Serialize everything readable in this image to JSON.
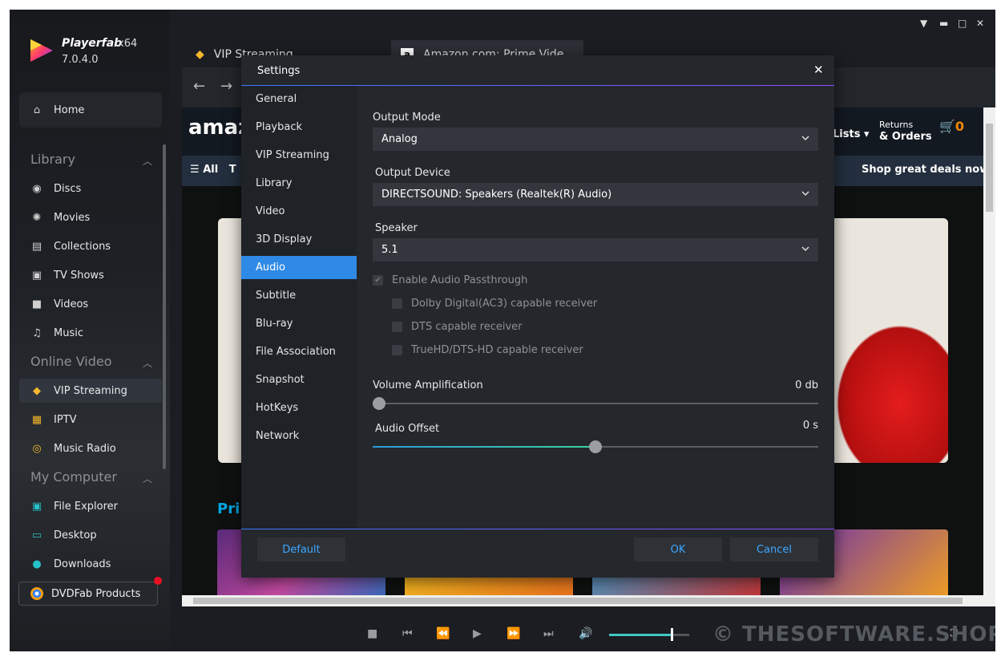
{
  "app": {
    "name": "Playerfab",
    "arch": "x64",
    "version": "7.0.4.0"
  },
  "sidebar": {
    "home": "Home",
    "sections": {
      "library": "Library",
      "online_video": "Online Video",
      "my_computer": "My Computer"
    },
    "library_items": [
      "Discs",
      "Movies",
      "Collections",
      "TV Shows",
      "Videos",
      "Music"
    ],
    "online_items": [
      "VIP Streaming",
      "IPTV",
      "Music Radio"
    ],
    "computer_items": [
      "File Explorer",
      "Desktop",
      "Downloads"
    ],
    "products": "DVDFab Products"
  },
  "tabs": {
    "tab1": "VIP Streaming",
    "tab2": "Amazon.com: Prime Vide"
  },
  "amazon": {
    "logo": "amaz",
    "lists": "Lists ▾",
    "returns_top": "Returns",
    "returns_bottom": "& Orders",
    "cart_count": "0",
    "all": "All",
    "all_next": "T",
    "deals": "Shop great deals now",
    "prime_label": "Pri"
  },
  "dialog": {
    "title": "Settings",
    "menu": [
      "General",
      "Playback",
      "VIP Streaming",
      "Library",
      "Video",
      "3D Display",
      "Audio",
      "Subtitle",
      "Blu-ray",
      "File Association",
      "Snapshot",
      "HotKeys",
      "Network"
    ],
    "active_menu": "Audio",
    "output_mode_label": "Output Mode",
    "output_mode_value": "Analog",
    "output_device_label": "Output Device",
    "output_device_value": "DIRECTSOUND: Speakers (Realtek(R) Audio)",
    "speaker_label": "Speaker",
    "speaker_value": "5.1",
    "passthrough_label": "Enable Audio Passthrough",
    "passthrough_checked": true,
    "receivers": [
      "Dolby Digital(AC3) capable receiver",
      "DTS capable receiver",
      "TrueHD/DTS-HD capable receiver"
    ],
    "volume_label": "Volume Amplification",
    "volume_value": "0 db",
    "volume_level": 0,
    "offset_label": "Audio Offset",
    "offset_value": "0 s",
    "offset_level": 0.5,
    "buttons": {
      "default": "Default",
      "ok": "OK",
      "cancel": "Cancel"
    }
  },
  "player": {
    "volume_level": 0.78
  },
  "watermark": "© THESOFTWARE.SHOP",
  "colors": {
    "accent": "#2f8ae5",
    "amazon_orange": "#f08804",
    "prime_blue": "#00a8e1"
  }
}
